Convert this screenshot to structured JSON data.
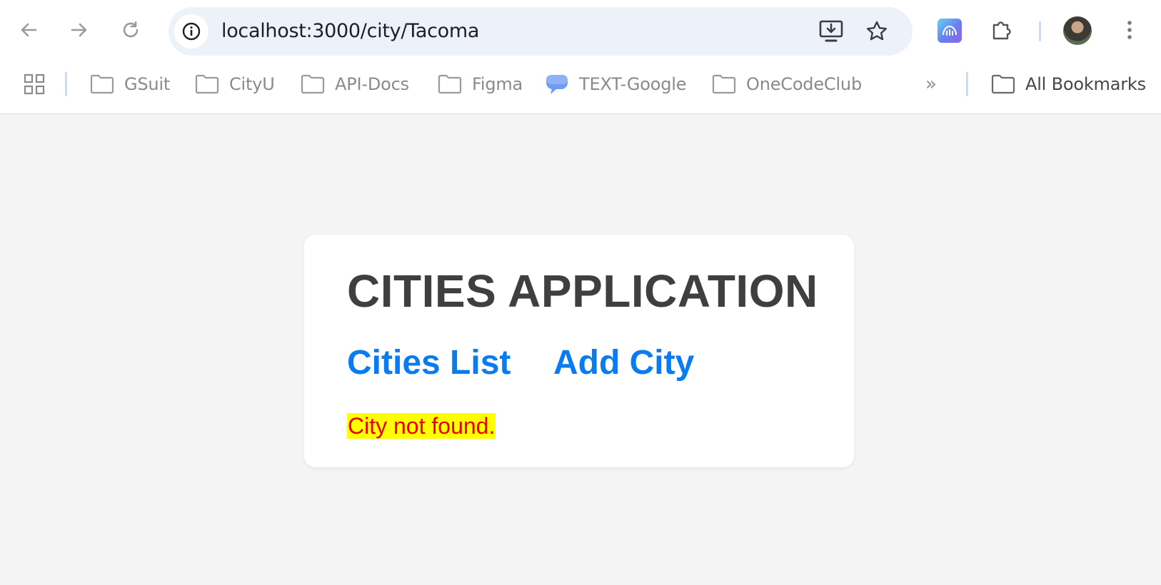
{
  "browser": {
    "url": "localhost:3000/city/Tacoma",
    "toolbar_icons": [
      "back-icon",
      "forward-icon",
      "reload-icon",
      "info-icon",
      "install-app-icon",
      "star-icon",
      "extension-app-icon",
      "puzzle-icon",
      "avatar",
      "more-vert-icon"
    ],
    "bookmarks": [
      {
        "label": "GSuit",
        "icon": "folder-icon"
      },
      {
        "label": "CityU",
        "icon": "folder-icon"
      },
      {
        "label": "API-Docs",
        "icon": "folder-icon"
      },
      {
        "label": "Figma",
        "icon": "folder-icon"
      },
      {
        "label": "TEXT-Google",
        "icon": "chat-bubble-icon"
      },
      {
        "label": "OneCodeClub",
        "icon": "folder-icon"
      }
    ],
    "overflow_label": "»",
    "all_bookmarks_label": "All Bookmarks"
  },
  "app": {
    "title": "CITIES APPLICATION",
    "nav": {
      "cities_list": "Cities List",
      "add_city": "Add City"
    },
    "message": "City not found."
  },
  "colors": {
    "link": "#0a7cf2",
    "title": "#3f3f3f",
    "error_text": "#e60000",
    "error_highlight": "#ffff00",
    "page_background": "#f4f4f4",
    "omnibox": "#ecf1fa"
  }
}
